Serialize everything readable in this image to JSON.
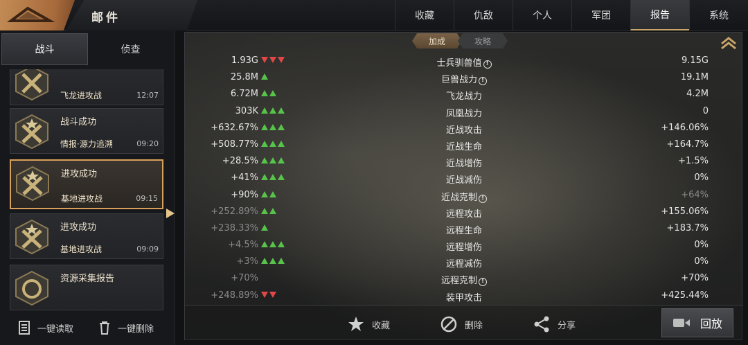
{
  "header": {
    "title": "邮件"
  },
  "tabs": [
    "收藏",
    "仇敌",
    "个人",
    "军团",
    "报告",
    "系统"
  ],
  "sidebar": {
    "subtabs": [
      "战斗",
      "侦查"
    ],
    "mails": [
      {
        "title": "",
        "subtitle": "飞龙进攻战",
        "time": "12:07"
      },
      {
        "title": "战斗成功",
        "subtitle": "情报·源力追溯",
        "time": "09:20"
      },
      {
        "title": "进攻成功",
        "subtitle": "基地进攻战",
        "time": "09:15"
      },
      {
        "title": "进攻成功",
        "subtitle": "基地进攻战",
        "time": "09:09"
      },
      {
        "title": "资源采集报告",
        "subtitle": "",
        "time": ""
      }
    ],
    "actions": {
      "read_all": "一键读取",
      "delete_all": "一键删除"
    }
  },
  "main": {
    "segments": [
      "加成",
      "攻略"
    ],
    "rows": [
      {
        "left": "1.93G",
        "arrows": "down3",
        "label": "士兵驯兽值",
        "info": true,
        "right": "9.15G"
      },
      {
        "left": "25.8M",
        "arrows": "up1",
        "label": "巨兽战力",
        "info": true,
        "right": "19.1M"
      },
      {
        "left": "6.72M",
        "arrows": "up2",
        "label": "飞龙战力",
        "info": false,
        "right": "4.2M"
      },
      {
        "left": "303K",
        "arrows": "up3",
        "label": "凤凰战力",
        "info": false,
        "right": "0"
      },
      {
        "left": "+632.67%",
        "arrows": "up3",
        "label": "近战攻击",
        "info": false,
        "right": "+146.06%"
      },
      {
        "left": "+508.77%",
        "arrows": "up3",
        "label": "近战生命",
        "info": false,
        "right": "+164.7%"
      },
      {
        "left": "+28.5%",
        "arrows": "up3",
        "label": "近战增伤",
        "info": false,
        "right": "+1.5%"
      },
      {
        "left": "+41%",
        "arrows": "up3",
        "label": "近战减伤",
        "info": false,
        "right": "0%"
      },
      {
        "left": "+90%",
        "arrows": "up2",
        "label": "近战克制",
        "info": true,
        "right": "+64%",
        "right_dim": true
      },
      {
        "left": "+252.89%",
        "arrows": "up2",
        "label": "远程攻击",
        "info": false,
        "right": "+155.06%",
        "left_dim": true
      },
      {
        "left": "+238.33%",
        "arrows": "up1",
        "label": "远程生命",
        "info": false,
        "right": "+183.7%",
        "left_dim": true
      },
      {
        "left": "+4.5%",
        "arrows": "up3",
        "label": "远程增伤",
        "info": false,
        "right": "0%",
        "left_dim": true
      },
      {
        "left": "+3%",
        "arrows": "up3",
        "label": "远程减伤",
        "info": false,
        "right": "0%",
        "left_dim": true
      },
      {
        "left": "+70%",
        "arrows": "",
        "label": "远程克制",
        "info": true,
        "right": "+70%",
        "left_dim": true
      },
      {
        "left": "+248.89%",
        "arrows": "down2",
        "label": "装甲攻击",
        "info": false,
        "right": "+425.44%",
        "left_dim": true
      }
    ],
    "footer": {
      "favorite": "收藏",
      "delete": "删除",
      "share": "分享",
      "replay": "回放"
    }
  }
}
